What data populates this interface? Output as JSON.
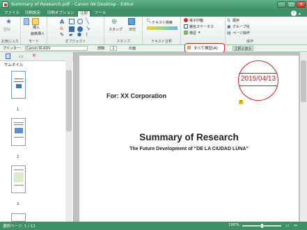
{
  "window": {
    "title": "Summary of Research.pdf - Canon iW Desktop - Editor"
  },
  "menu": [
    "ファイル",
    "印刷設定",
    "印刷オプション",
    "注釈",
    "ツール"
  ],
  "ribbon": {
    "fav_label": "お気に入り",
    "mode_group": "モード",
    "object_group": "オブジェクト",
    "stamp_group": "スタンプ",
    "text_annot_group": "テキスト注釈",
    "op_group": "操作",
    "select_btn": "選択",
    "insert_btn": "挿入",
    "image_insert": "画像挿入",
    "stamp_btn": "スタンプ",
    "date_btn": "日付",
    "text_search": "テキスト検索",
    "digital_sign": "電子印鑑",
    "sign_status": "署名ステータス",
    "verify": "検証",
    "sort": "順序",
    "group": "グループ化",
    "page_op": "ページ操作"
  },
  "toolbar": {
    "printer_label": "プリンター:",
    "printer_value": "Canon iR-ADV",
    "copies_label": "部数:",
    "copies_value": "1",
    "duplex": "片面",
    "show_annot": "注釈の表示"
  },
  "popup": {
    "verify_all": "すべて検証(A)"
  },
  "left_pane": {
    "title": "サムネイル",
    "pages": [
      "1",
      "2",
      "3"
    ]
  },
  "document": {
    "for_line": "For: XX Corporation",
    "stamp_date": "2015/04/13",
    "heading": "Summary of Research",
    "subheading": "The Future Development of “DE LA CIUDAD LUNA”"
  },
  "status": {
    "page_info": "選択ページ: 1 / 11",
    "zoom": "100%"
  },
  "colors": {
    "accent": "#3f8f66",
    "stamp_red": "#d81b1b",
    "highlight": "#e0201e"
  }
}
